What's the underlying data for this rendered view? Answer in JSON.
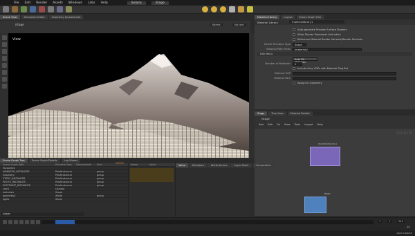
{
  "menubar": {
    "items": [
      "File",
      "Edit",
      "Render",
      "Assets",
      "Windows",
      "Labs",
      "Help"
    ],
    "desktop": "Solaris",
    "context": "Stage"
  },
  "viewport": {
    "tabs": [
      "Scene View",
      "Animation Editor",
      "Geometry Spreadsheet"
    ],
    "path": "/stage",
    "label": "View",
    "renderer": "Karma",
    "camera": "No cam"
  },
  "properties": {
    "tabs": [
      "Material Library",
      "Layout",
      "Scene Graph Tree"
    ],
    "node_type": "Material Library",
    "node_name": "materiallibrary1",
    "rows": [
      {
        "label": "",
        "value": "Auto-generate Preview Surface Shaders",
        "type": "check"
      },
      {
        "label": "",
        "value": "Allow Shader Parameter Animation",
        "type": "check"
      },
      {
        "label": "",
        "value": "Reference Material Render Variants/Render Products",
        "type": "check"
      },
      {
        "label": "Parent Primitive Type",
        "value": "Scope",
        "type": "field"
      },
      {
        "label": "Material Path Prefix",
        "value": "/materials/",
        "type": "field"
      },
      {
        "label": "Edit Menu",
        "value": "",
        "type": "header"
      },
      {
        "label": "",
        "value": "Auto Fill Materials",
        "type": "button"
      },
      {
        "label": "Number of Materials",
        "value": "1",
        "type": "field"
      },
      {
        "label": "",
        "value": "Include Only VOPs with Material Flag Set",
        "type": "check"
      },
      {
        "label": "Material VOP",
        "value": "",
        "type": "field"
      },
      {
        "label": "Material Path",
        "value": "",
        "type": "field"
      },
      {
        "label": "",
        "value": "Assign to Geometry",
        "type": "check"
      }
    ]
  },
  "network": {
    "tabs": [
      "Stage",
      "Tree View",
      "Material Palette"
    ],
    "path": "/stage",
    "menu": [
      "Add",
      "Edit",
      "Go",
      "View",
      "Tools",
      "Layout",
      "Help"
    ],
    "context_label": "Solaris",
    "nodes": [
      {
        "name": "materiallibrary1",
        "color": "#7a67b8"
      },
      {
        "name": "stage",
        "color": "#4f81bd"
      }
    ]
  },
  "scene_graph": {
    "tabs": [
      "Scene Graph Tree",
      "Scene Graph Details",
      "Log Viewer"
    ],
    "columns": [
      "Scene Graph Path",
      "Primitive Type",
      "Descendants",
      "Kind"
    ],
    "rows": [
      {
        "path": "Favourites",
        "type": "",
        "desc": "",
        "kind": ""
      },
      {
        "path": "  ANIMATED_INSTANCER",
        "type": "PointInstancer",
        "desc": "",
        "kind": "group"
      },
      {
        "path": "  Geometry",
        "type": "PointInstancer",
        "desc": "",
        "kind": "group"
      },
      {
        "path": "  STATIC_INSTANCER",
        "type": "PointInstancer",
        "desc": "",
        "kind": "group"
      },
      {
        "path": "  PHOTO_INSTANCER",
        "type": "PointInstancer",
        "desc": "",
        "kind": "group"
      },
      {
        "path": "  RESTPOINT_INSTANCER",
        "type": "PointInstancer",
        "desc": "",
        "kind": "group"
      },
      {
        "path": "  cam1",
        "type": "Camera",
        "desc": "",
        "kind": ""
      },
      {
        "path": "  materials",
        "type": "Scope",
        "desc": "",
        "kind": ""
      },
      {
        "path": "  geometry2",
        "type": "Xform",
        "desc": "",
        "kind": "group"
      },
      {
        "path": "  lights",
        "type": "Xform",
        "desc": "",
        "kind": ""
      }
    ],
    "filter": "/stage"
  },
  "collection": {
    "columns": [
      "Name",
      "Value"
    ]
  },
  "attributes": {
    "tabs": [
      "Value",
      "Metadata",
      "Attrib Source",
      "Layer Stack",
      "Composition"
    ]
  },
  "timeline": {
    "start": "1",
    "end": "240",
    "current": "1",
    "fps": "24"
  },
  "status": {
    "text": "Auto Update"
  }
}
